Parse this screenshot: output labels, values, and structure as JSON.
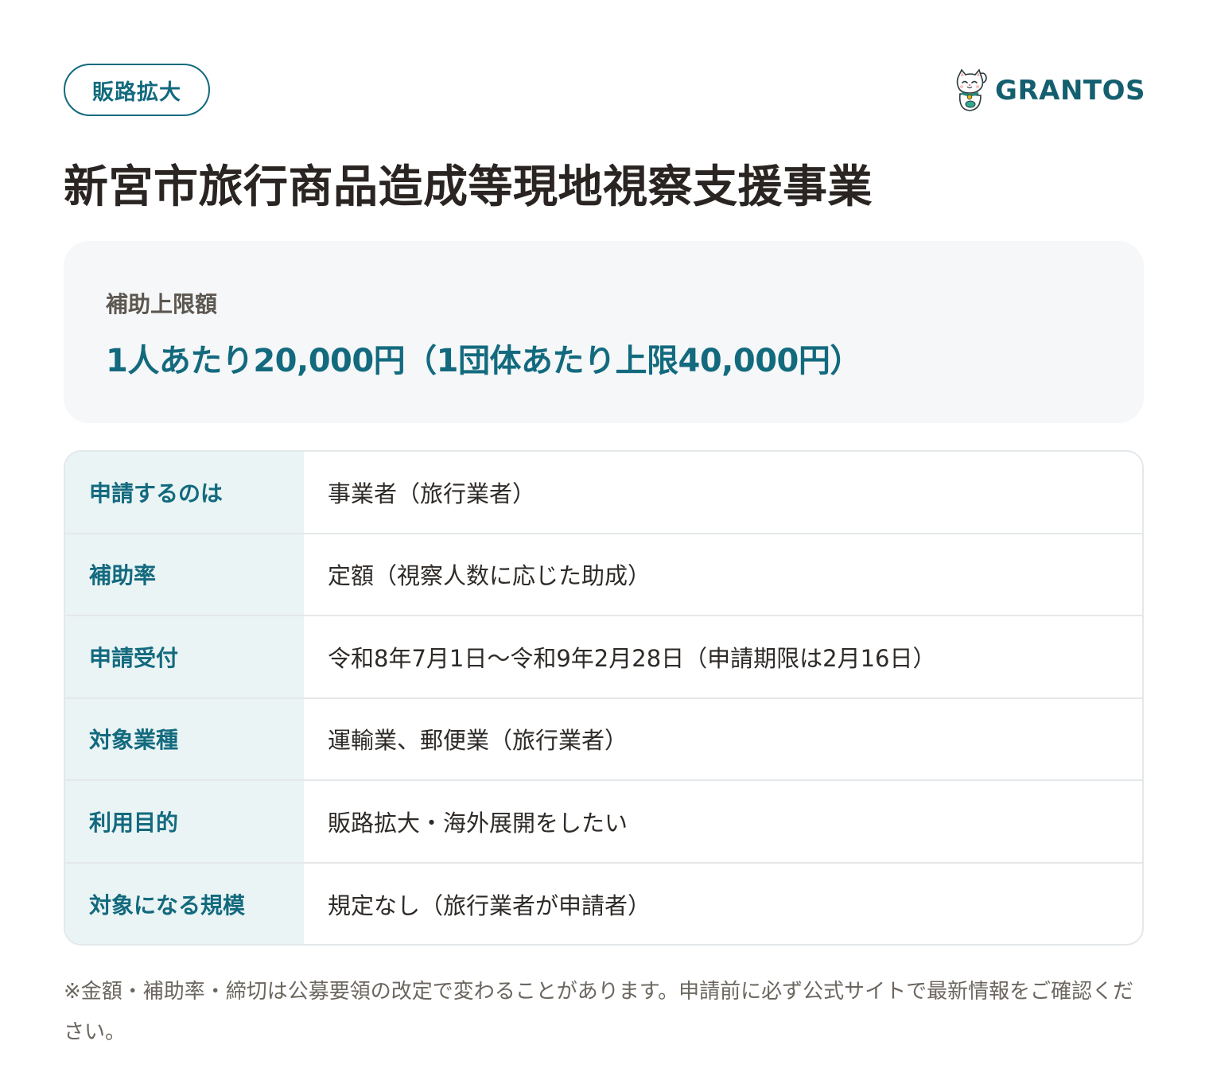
{
  "category": "販路拡大",
  "brand": {
    "name": "GRANTOS",
    "logo_icon": "lucky-cat-icon",
    "color": "#145f6f"
  },
  "title": "新宮市旅行商品造成等現地視察支援事業",
  "amount": {
    "label": "補助上限額",
    "value": "1人あたり20,000円（1団体あたり上限40,000円）"
  },
  "details": [
    {
      "key": "申請するのは",
      "value": "事業者（旅行業者）"
    },
    {
      "key": "補助率",
      "value": "定額（視察人数に応じた助成）"
    },
    {
      "key": "申請受付",
      "value": "令和8年7月1日〜令和9年2月28日（申請期限は2月16日）"
    },
    {
      "key": "対象業種",
      "value": "運輸業、郵便業（旅行業者）"
    },
    {
      "key": "利用目的",
      "value": "販路拡大・海外展開をしたい"
    },
    {
      "key": "対象になる規模",
      "value": "規定なし（旅行業者が申請者）"
    }
  ],
  "footnote": "※金額・補助率・締切は公募要領の改定で変わることがあります。申請前に必ず公式サイトで最新情報をご確認ください。",
  "colors": {
    "accent": "#136a7e",
    "key_background": "#eaf4f5",
    "card_background": "#f5f7f8",
    "border": "#e4e8ea"
  }
}
